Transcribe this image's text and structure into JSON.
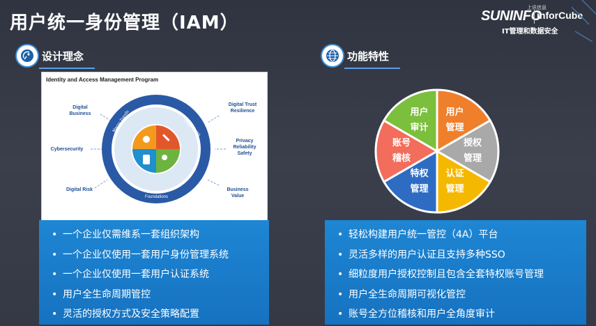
{
  "slide": {
    "title": "用户统一身份管理（IAM）"
  },
  "logo": {
    "brand": "SUNINFO",
    "brand_cn": "上讯信息",
    "product": "inforCube",
    "tagline": "IT管理和数据安全"
  },
  "left": {
    "heading": "设计理念",
    "diagram": {
      "title": "Identity and Access Management Program",
      "labels": {
        "digital_business": "Digital Business",
        "cybersecurity": "Cybersecurity",
        "digital_risk": "Digital Risk",
        "digital_trust": "Digital Trust Resilience",
        "privacy": "Privacy Reliability Safety",
        "business_value": "Business Value",
        "macro_trends": "Macro Trends",
        "resourcing": "Resourcing",
        "foundations": "Foundations"
      }
    },
    "bullets": [
      "一个企业仅需维系一套组织架构",
      "一个企业仅使用一套用户身份管理系统",
      "一个企业仅使用一套用户认证系统",
      "用户全生命周期管控",
      "灵活的授权方式及安全策略配置"
    ]
  },
  "right": {
    "heading": "功能特性",
    "pie": [
      {
        "l1": "用户",
        "l2": "管理",
        "color": "#f07f2c"
      },
      {
        "l1": "授权",
        "l2": "管理",
        "color": "#a9a9a9"
      },
      {
        "l1": "认证",
        "l2": "管理",
        "color": "#f5b800"
      },
      {
        "l1": "特权",
        "l2": "管理",
        "color": "#2e6cc4"
      },
      {
        "l1": "账号",
        "l2": "稽核",
        "color": "#f26d5b"
      },
      {
        "l1": "用户",
        "l2": "审计",
        "color": "#7bbf3d"
      }
    ],
    "bullets": [
      "轻松构建用户统一管控（4A）平台",
      "灵活多样的用户认证且支持多种SSO",
      "细粒度用户授权控制且包含全套特权账号管理",
      "用户全生命周期可视化管控",
      "账号全方位稽核和用户全角度审计"
    ]
  },
  "colors": {
    "bullet_panel": "#1a7ccb",
    "accent_line": "#5aa0e6"
  }
}
